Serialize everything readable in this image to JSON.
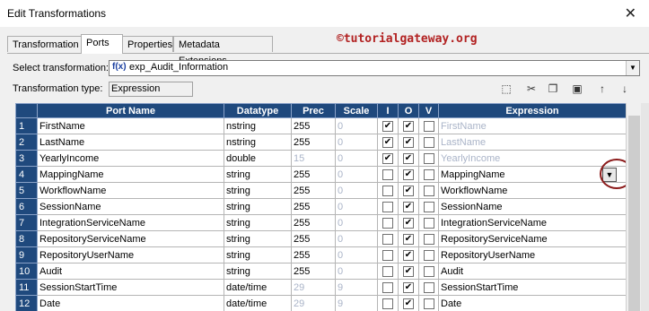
{
  "window": {
    "title": "Edit Transformations",
    "close_glyph": "✕"
  },
  "tabs": [
    {
      "label": "Transformation"
    },
    {
      "label": "Ports",
      "active": true
    },
    {
      "label": "Properties"
    },
    {
      "label": "Metadata Extensions"
    }
  ],
  "watermark": "©tutorialgateway.org",
  "select_transformation": {
    "label": "Select transformation:",
    "icon_text": "f(x)",
    "value": "exp_Audit_Information"
  },
  "transformation_type": {
    "label": "Transformation type:",
    "value": "Expression"
  },
  "toolbar_icons": [
    "new-port-icon",
    "cut-icon",
    "copy-icon",
    "paste-icon",
    "move-up-icon",
    "move-down-icon"
  ],
  "grid": {
    "headers": [
      "",
      "Port Name",
      "Datatype",
      "Prec",
      "Scale",
      "I",
      "O",
      "V",
      "Expression"
    ],
    "rows": [
      {
        "no": "1",
        "name": "FirstName",
        "datatype": "nstring",
        "prec": "255",
        "scale": "0",
        "i": true,
        "o": true,
        "v": false,
        "expr": "FirstName",
        "expr_dim": true
      },
      {
        "no": "2",
        "name": "LastName",
        "datatype": "nstring",
        "prec": "255",
        "scale": "0",
        "i": true,
        "o": true,
        "v": false,
        "expr": "LastName",
        "expr_dim": true
      },
      {
        "no": "3",
        "name": "YearlyIncome",
        "datatype": "double",
        "prec": "15",
        "prec_dim": true,
        "scale": "0",
        "i": true,
        "o": true,
        "v": false,
        "expr": "YearlyIncome",
        "expr_dim": true
      },
      {
        "no": "4",
        "name": "MappingName",
        "datatype": "string",
        "prec": "255",
        "scale": "0",
        "i": false,
        "o": true,
        "v": false,
        "expr": "MappingName",
        "expr_dim": false
      },
      {
        "no": "5",
        "name": "WorkflowName",
        "datatype": "string",
        "prec": "255",
        "scale": "0",
        "i": false,
        "o": true,
        "v": false,
        "expr": "WorkflowName",
        "expr_dim": false
      },
      {
        "no": "6",
        "name": "SessionName",
        "datatype": "string",
        "prec": "255",
        "scale": "0",
        "i": false,
        "o": true,
        "v": false,
        "expr": "SessionName",
        "expr_dim": false
      },
      {
        "no": "7",
        "name": "IntegrationServiceName",
        "datatype": "string",
        "prec": "255",
        "scale": "0",
        "i": false,
        "o": true,
        "v": false,
        "expr": "IntegrationServiceName",
        "expr_dim": false
      },
      {
        "no": "8",
        "name": "RepositoryServiceName",
        "datatype": "string",
        "prec": "255",
        "scale": "0",
        "i": false,
        "o": true,
        "v": false,
        "expr": "RepositoryServiceName",
        "expr_dim": false
      },
      {
        "no": "9",
        "name": "RepositoryUserName",
        "datatype": "string",
        "prec": "255",
        "scale": "0",
        "i": false,
        "o": true,
        "v": false,
        "expr": "RepositoryUserName",
        "expr_dim": false
      },
      {
        "no": "10",
        "name": "Audit",
        "datatype": "string",
        "prec": "255",
        "scale": "0",
        "i": false,
        "o": true,
        "v": false,
        "expr": "Audit",
        "expr_dim": false
      },
      {
        "no": "11",
        "name": "SessionStartTime",
        "datatype": "date/time",
        "prec": "29",
        "prec_dim": true,
        "scale": "9",
        "i": false,
        "o": true,
        "v": false,
        "expr": "SessionStartTime",
        "expr_dim": false
      },
      {
        "no": "12",
        "name": "Date",
        "datatype": "date/time",
        "prec": "29",
        "prec_dim": true,
        "scale": "9",
        "i": false,
        "o": true,
        "v": false,
        "expr": "Date",
        "expr_dim": false
      }
    ]
  },
  "colors": {
    "header_bg": "#1f497d",
    "annotation_circle": "#8b1a1a",
    "watermark": "#b22222"
  }
}
